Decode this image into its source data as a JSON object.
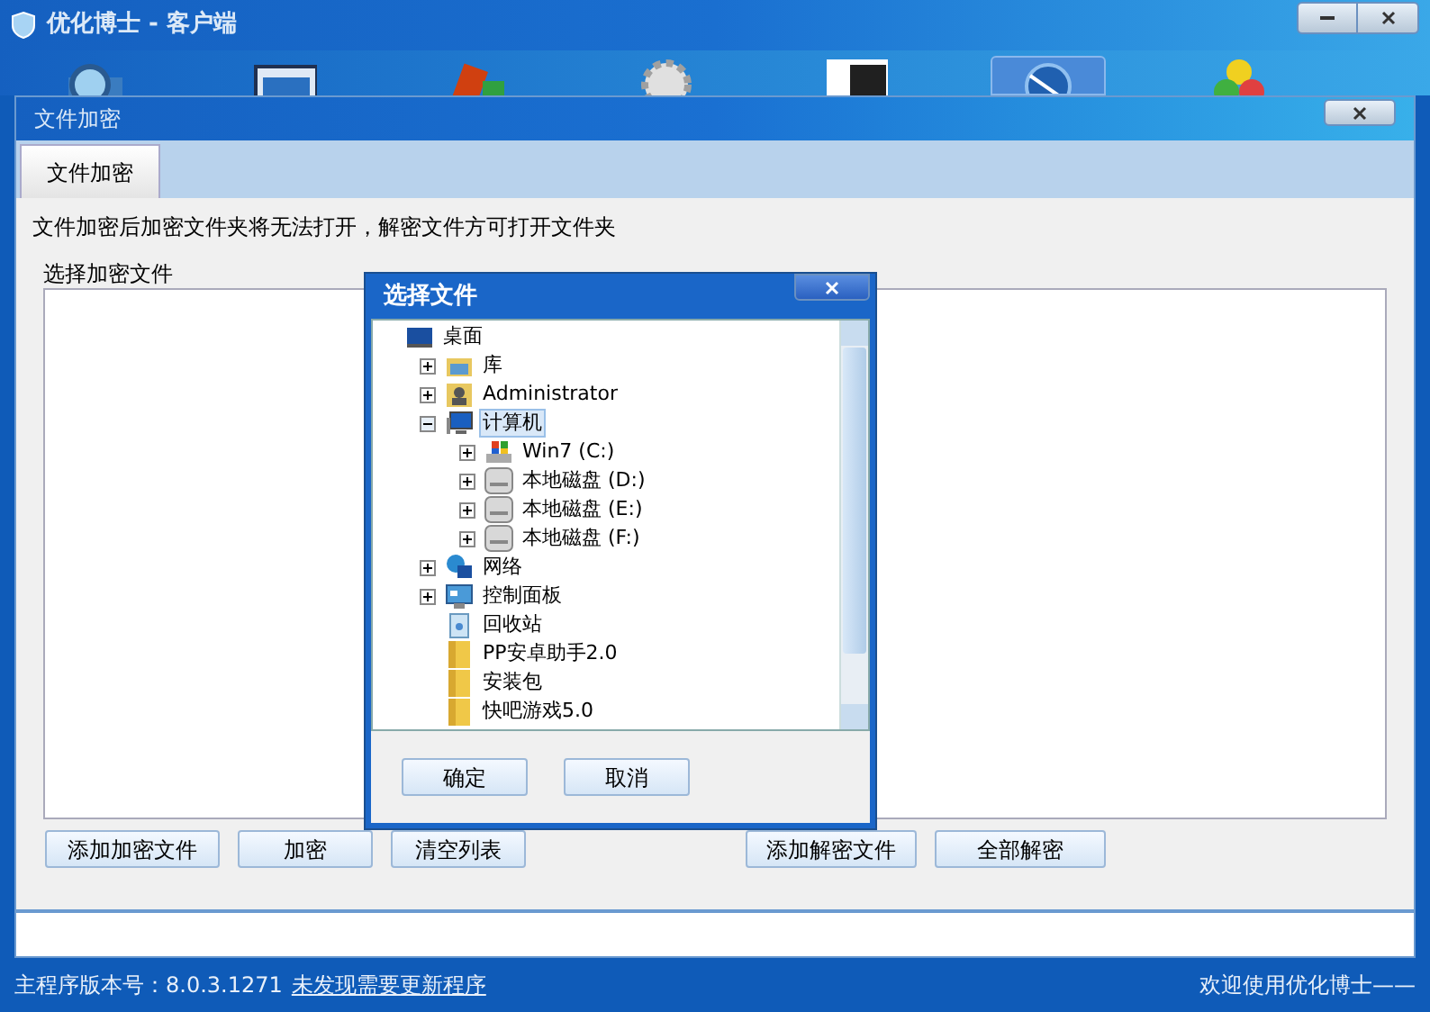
{
  "window": {
    "title": "优化博士 - 客户端"
  },
  "toolbar": [
    {
      "selected": false
    },
    {
      "selected": false
    },
    {
      "selected": false
    },
    {
      "selected": false
    },
    {
      "selected": false
    },
    {
      "selected": true
    },
    {
      "selected": false
    }
  ],
  "panel": {
    "title": "文件加密",
    "tabs": [
      {
        "label": "文件加密",
        "selected": true
      }
    ],
    "description": "文件加密后加密文件夹将无法打开，解密文件方可打开文件夹",
    "left_label": "选择加密文件",
    "left_buttons": [
      "添加加密文件",
      "加密",
      "清空列表"
    ],
    "right_buttons": [
      "添加解密文件",
      "全部解密"
    ]
  },
  "dialog": {
    "title": "选择文件",
    "tree": [
      {
        "label": "桌面",
        "kind": "desktop",
        "selected": false,
        "children": [
          {
            "label": "库",
            "kind": "library",
            "expanded": false,
            "selected": false
          },
          {
            "label": "Administrator",
            "kind": "user",
            "expanded": false,
            "selected": false
          },
          {
            "label": "计算机",
            "kind": "computer",
            "expanded": true,
            "selected": true,
            "children": [
              {
                "label": "Win7 (C:)",
                "kind": "system-drive",
                "expanded": false,
                "selected": false
              },
              {
                "label": "本地磁盘 (D:)",
                "kind": "drive",
                "expanded": false,
                "selected": false
              },
              {
                "label": "本地磁盘 (E:)",
                "kind": "drive",
                "expanded": false,
                "selected": false
              },
              {
                "label": "本地磁盘 (F:)",
                "kind": "drive",
                "expanded": false,
                "selected": false
              }
            ]
          },
          {
            "label": "网络",
            "kind": "network",
            "expanded": false,
            "selected": false
          },
          {
            "label": "控制面板",
            "kind": "control-panel",
            "expanded": false,
            "selected": false
          },
          {
            "label": "回收站",
            "kind": "recycle-bin",
            "selected": false
          },
          {
            "label": "PP安卓助手2.0",
            "kind": "folder",
            "selected": false
          },
          {
            "label": "安装包",
            "kind": "folder",
            "selected": false
          },
          {
            "label": "快吧游戏5.0",
            "kind": "folder",
            "selected": false
          }
        ]
      }
    ],
    "buttons": [
      "确定",
      "取消"
    ]
  },
  "status_bar": {
    "version": "主程序版本号：8.0.3.1271",
    "update_link": "未发现需要更新程序",
    "welcome": "欢迎使用优化博士——"
  }
}
